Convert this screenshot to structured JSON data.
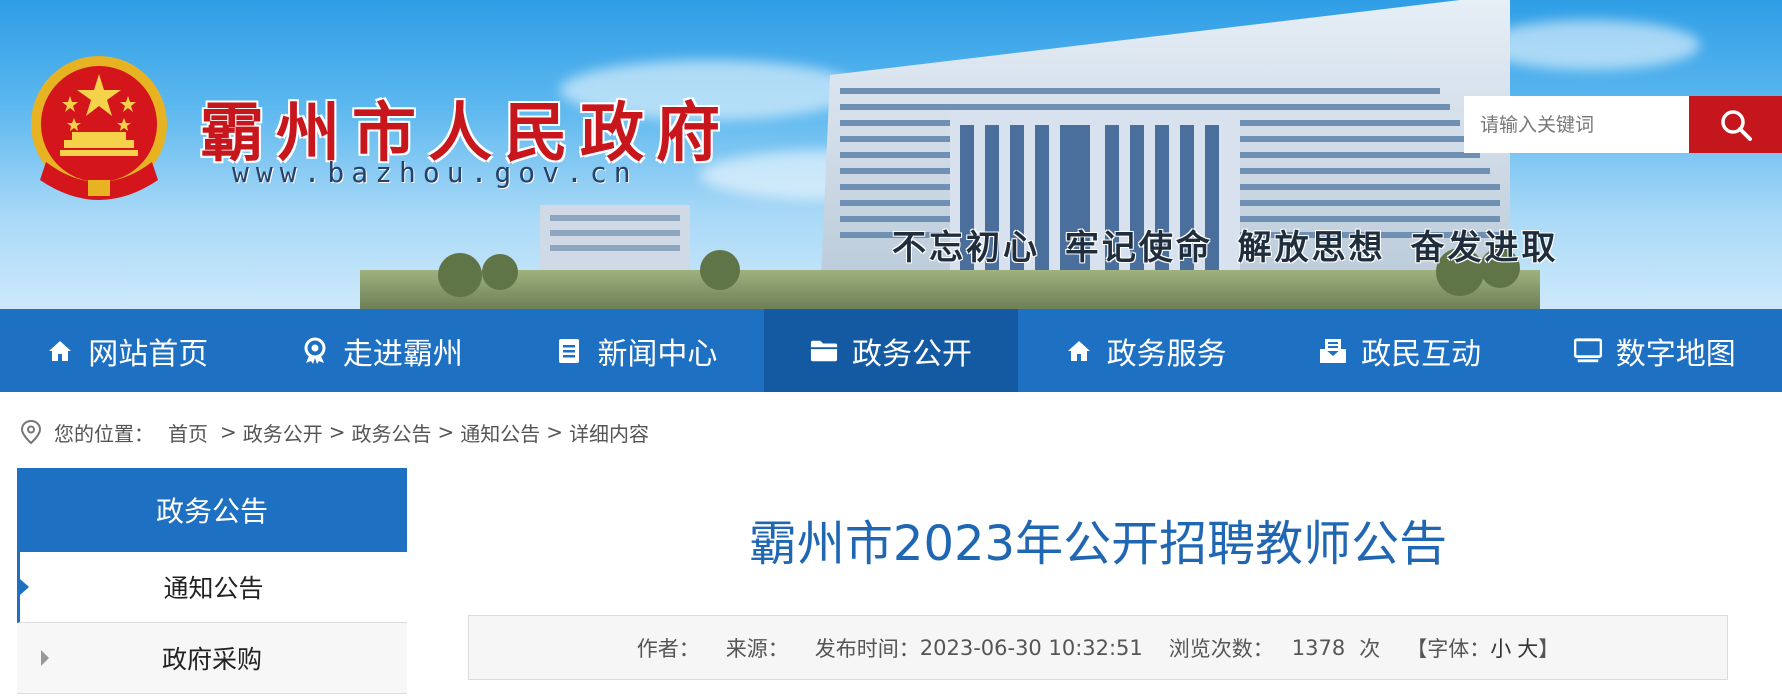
{
  "header": {
    "site_title": "霸州市人民政府",
    "site_url": "www.bazhou.gov.cn",
    "slogan": "不忘初心  牢记使命  解放思想  奋发进取",
    "search": {
      "placeholder": "请输入关键词"
    }
  },
  "nav": {
    "items": [
      {
        "label": "网站首页",
        "icon": "home-icon"
      },
      {
        "label": "走进霸州",
        "icon": "location-badge-icon"
      },
      {
        "label": "新闻中心",
        "icon": "document-icon"
      },
      {
        "label": "政务公开",
        "icon": "folder-icon"
      },
      {
        "label": "政务服务",
        "icon": "home-icon"
      },
      {
        "label": "政民互动",
        "icon": "mail-tray-icon"
      },
      {
        "label": "数字地图",
        "icon": "monitor-icon"
      }
    ],
    "active_index": 3
  },
  "breadcrumb": {
    "prefix": "您的位置：",
    "items": [
      "首页",
      "政务公开",
      "政务公告",
      "通知公告",
      "详细内容"
    ],
    "separator": ">"
  },
  "sidebar": {
    "title": "政务公告",
    "items": [
      {
        "label": "通知公告",
        "active": true
      },
      {
        "label": "政府采购",
        "active": false
      }
    ]
  },
  "article": {
    "title": "霸州市2023年公开招聘教师公告",
    "meta": {
      "author_label": "作者：",
      "source_label": "来源：",
      "publish_label": "发布时间：",
      "publish_time": "2023-06-30 10:32:51",
      "views_label": "浏览次数：",
      "views": "1378",
      "views_unit": "次",
      "font_prefix": "【字体：",
      "font_small": "小",
      "font_large": "大",
      "font_suffix": "】"
    }
  },
  "colors": {
    "brand_blue": "#1e70c2",
    "nav_active": "#135aa3",
    "title_red": "#c8161d",
    "search_red": "#c4161c",
    "article_title": "#1f66b3"
  }
}
